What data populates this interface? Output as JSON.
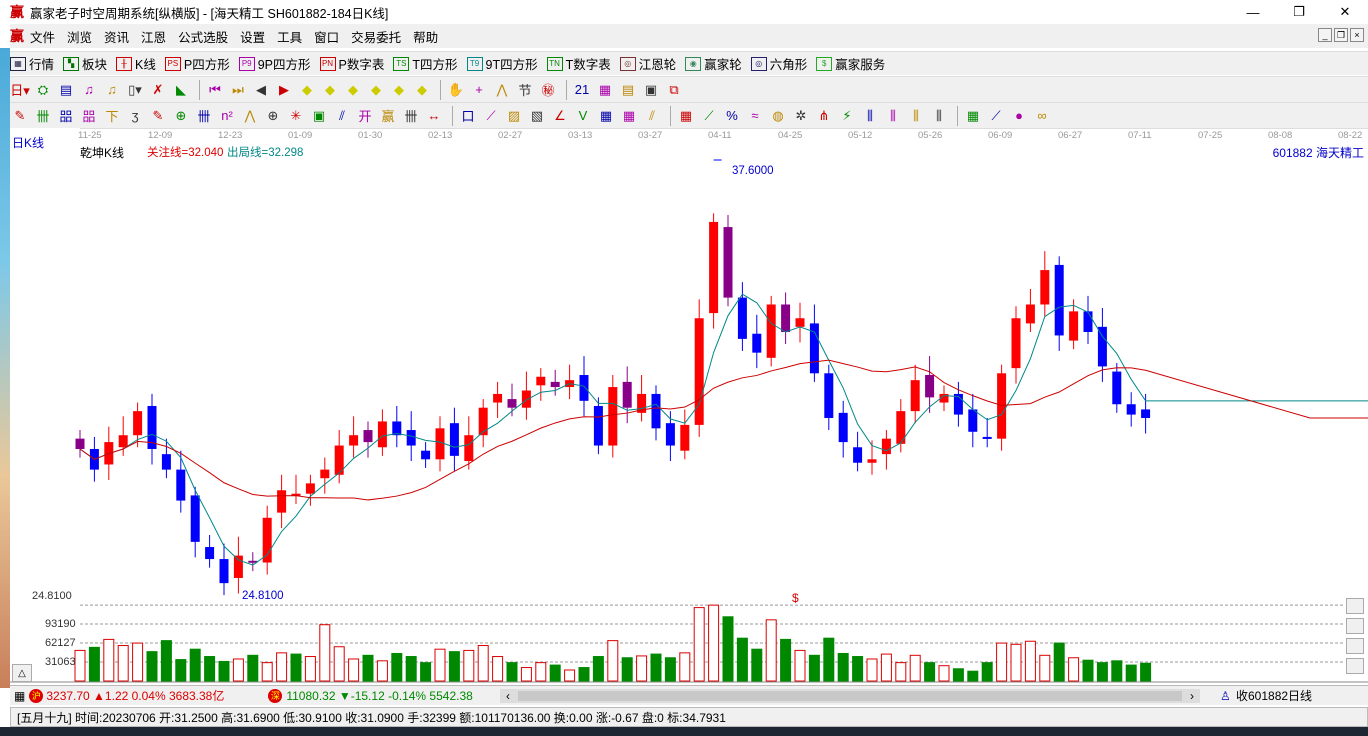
{
  "window": {
    "logo": "赢",
    "title": "赢家老子时空周期系统[纵横版] - [海天精工  SH601882-184日K线]",
    "min": "—",
    "max": "❐",
    "close": "✕"
  },
  "menu": [
    "文件",
    "浏览",
    "资讯",
    "江恩",
    "公式选股",
    "设置",
    "工具",
    "窗口",
    "交易委托",
    "帮助"
  ],
  "toolbar1": [
    {
      "label": "行情",
      "icon": "grid-icon",
      "glyph": "▦",
      "color": "#224"
    },
    {
      "label": "板块",
      "icon": "blocks-icon",
      "glyph": "▚",
      "color": "#070"
    },
    {
      "label": "K线",
      "icon": "kline-icon",
      "glyph": "╫",
      "color": "#c00"
    },
    {
      "label": "P四方形",
      "icon": "ps-icon",
      "glyph": "PS",
      "color": "#c00"
    },
    {
      "label": "9P四方形",
      "icon": "p9-icon",
      "glyph": "P9",
      "color": "#a0a"
    },
    {
      "label": "P数字表",
      "icon": "pn-icon",
      "glyph": "PN",
      "color": "#c00"
    },
    {
      "label": "T四方形",
      "icon": "ts-icon",
      "glyph": "TS",
      "color": "#080"
    },
    {
      "label": "9T四方形",
      "icon": "t9-icon",
      "glyph": "T9",
      "color": "#088"
    },
    {
      "label": "T数字表",
      "icon": "tn-icon",
      "glyph": "TN",
      "color": "#080"
    },
    {
      "label": "江恩轮",
      "icon": "gann-wheel-icon",
      "glyph": "◎",
      "color": "#733"
    },
    {
      "label": "赢家轮",
      "icon": "winner-wheel-icon",
      "glyph": "◉",
      "color": "#385"
    },
    {
      "label": "六角形",
      "icon": "hexagon-icon",
      "glyph": "◎",
      "color": "#226"
    },
    {
      "label": "赢家服务",
      "icon": "dollar-icon",
      "glyph": "$",
      "color": "#2a2"
    }
  ],
  "toolbar2": [
    "日▾",
    "⛭",
    "▤",
    "♫",
    "♫",
    "▯▾",
    "✗",
    "◣",
    "|",
    "⏮",
    "⏭",
    "◀",
    "▶",
    "◆",
    "◆",
    "◆",
    "◆",
    "◆",
    "◆",
    "|",
    "✋",
    "+",
    "⋀",
    "节",
    "㊙",
    "|",
    "21",
    "▦",
    "▤",
    "▣",
    "⧉"
  ],
  "toolbar3": [
    "✎",
    "卌",
    "㗊",
    "㗊",
    "下",
    "ʒ",
    "✎",
    "⊕",
    "卌",
    "n²",
    "⋀",
    "⊕",
    "✳",
    "▣",
    "⫽",
    "开",
    "赢",
    "卌",
    "↔",
    "|",
    "口",
    "⟋",
    "▨",
    "▧",
    "∠",
    "V",
    "▦",
    "▦",
    "⫽",
    "|",
    "▦",
    "⟋",
    "%",
    "≈",
    "◍",
    "✲",
    "⋔",
    "⚡",
    "⫼",
    "⫼",
    "⫼",
    "⫼",
    "|",
    "▦",
    "⟋",
    "●",
    "∞"
  ],
  "chart": {
    "period_label": "日K线",
    "indicator_name": "乾坤K线",
    "focus_line": "关注线=32.040",
    "exit_line": "出局线=32.298",
    "stock_label": "601882  海天精工",
    "high_label": "37.6000",
    "low_label": "24.8100",
    "dollar_mark": "$",
    "date_ticks": [
      "11-25",
      "12-09",
      "12-23",
      "01-09",
      "01-30",
      "02-13",
      "02-27",
      "03-13",
      "03-27",
      "04-11",
      "04-25",
      "05-12",
      "05-26",
      "06-09",
      "06-27",
      "07-11",
      "07-25",
      "08-08",
      "08-22"
    ],
    "volume_axis": [
      "24.8100",
      "93190",
      "62127",
      "31063"
    ],
    "collapse_btn": "△"
  },
  "chart_data": {
    "type": "candlestick",
    "price_range": [
      24.81,
      37.6
    ],
    "closes": [
      29.2,
      28.6,
      29.4,
      29.6,
      30.3,
      29.2,
      28.6,
      27.7,
      26.5,
      26.0,
      25.3,
      26.1,
      25.9,
      27.2,
      28.0,
      27.9,
      28.2,
      28.6,
      29.3,
      29.6,
      29.4,
      30.0,
      29.6,
      29.3,
      28.9,
      29.8,
      29.0,
      29.6,
      30.4,
      30.8,
      30.4,
      30.9,
      31.3,
      31.0,
      31.2,
      30.6,
      29.3,
      31.0,
      30.4,
      30.8,
      29.8,
      29.3,
      29.9,
      33.0,
      35.8,
      33.6,
      32.4,
      32.0,
      33.4,
      32.6,
      33.0,
      31.4,
      30.1,
      29.4,
      28.8,
      28.9,
      29.5,
      30.3,
      31.2,
      30.7,
      30.8,
      30.2,
      29.7,
      29.5,
      31.4,
      33.0,
      33.4,
      34.4,
      32.5,
      33.2,
      32.6,
      31.6,
      30.5,
      30.2,
      30.1
    ],
    "volumes": [
      50000,
      55000,
      68000,
      58000,
      62000,
      48000,
      66000,
      35000,
      52000,
      40000,
      32000,
      36000,
      42000,
      30000,
      46000,
      44000,
      40000,
      92000,
      56000,
      36000,
      42000,
      33000,
      45000,
      40000,
      30000,
      52000,
      48000,
      50000,
      58000,
      40000,
      30000,
      22000,
      30000,
      26000,
      18000,
      22000,
      40000,
      66000,
      38000,
      41000,
      44000,
      38000,
      46000,
      120000,
      124000,
      105000,
      70000,
      52000,
      100000,
      68000,
      50000,
      42000,
      70000,
      45000,
      40000,
      36000,
      44000,
      30000,
      42000,
      30000,
      25000,
      20000,
      16000,
      30000,
      62000,
      60000,
      65000,
      42000,
      62000,
      38000,
      34000,
      30000,
      33000,
      26000,
      29000
    ],
    "volume_ticks": [
      31063,
      62127,
      93190
    ]
  },
  "status_bar": {
    "sh_icon": "沪",
    "sh_text": "3237.70 ▲1.22 0.04% 3683.38亿",
    "sz_icon": "深",
    "sz_text": "11080.32 ▼-15.12 -0.14% 5542.38",
    "scroll_left": "‹",
    "scroll_right": "›",
    "right_label": "收601882日线"
  },
  "info_bar": "[五月十九] 时间:20230706 开:31.2500 高:31.6900 低:30.9100 收:31.0900 手:32399 额:101170136.00 换:0.00 涨:-0.67 盘:0 标:34.7931"
}
